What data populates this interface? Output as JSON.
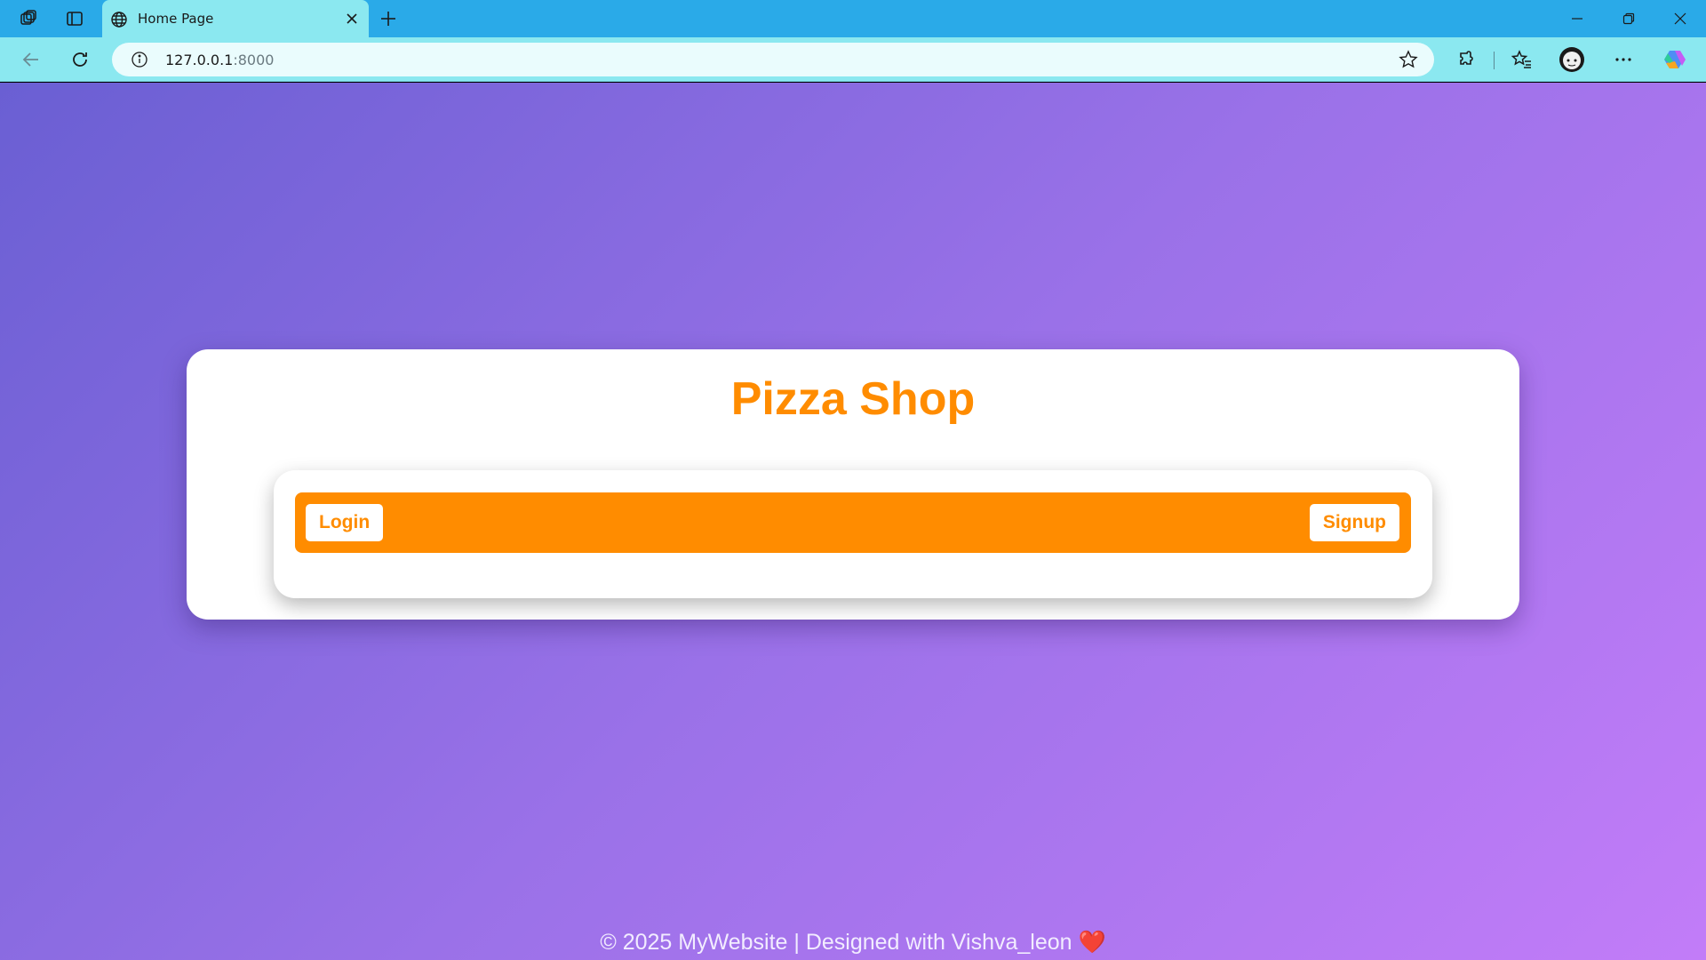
{
  "browser": {
    "tab_title": "Home Page",
    "url_host": "127.0.0.1",
    "url_port": ":8000"
  },
  "page": {
    "title": "Pizza Shop",
    "nav": {
      "login_label": "Login",
      "signup_label": "Signup"
    },
    "footer_text": "© 2025 MyWebsite | Designed with Vishva_leon",
    "footer_heart": "❤️"
  },
  "colors": {
    "accent": "#ff8c00",
    "gradient_start": "#6a5fd3",
    "gradient_end": "#c27cf8",
    "titlebar": "#2aaae8",
    "toolbar": "#8be8f0"
  },
  "icons": [
    "workspaces-icon",
    "tab-actions-icon",
    "globe-icon",
    "close-icon",
    "plus-icon",
    "minimize-icon",
    "restore-icon",
    "window-close-icon",
    "back-icon",
    "refresh-icon",
    "info-icon",
    "star-icon",
    "extensions-icon",
    "favorites-icon",
    "profile-avatar",
    "more-icon",
    "copilot-icon"
  ]
}
